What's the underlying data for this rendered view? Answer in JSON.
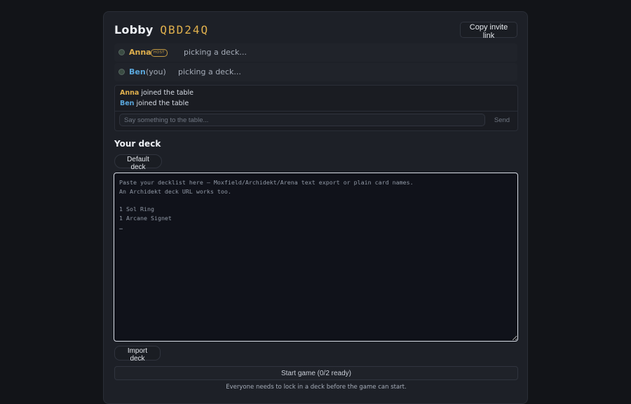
{
  "lobby": {
    "title": "Lobby",
    "code": "QBD24Q",
    "copy_invite_label": "Copy invite link"
  },
  "players": [
    {
      "name": "Anna",
      "badge": "HOST",
      "you_label": "",
      "status": "picking a deck..."
    },
    {
      "name": "Ben",
      "badge": "",
      "you_label": "(you)",
      "status": "picking a deck..."
    }
  ],
  "chat": {
    "messages": [
      {
        "name": "Anna",
        "text": "joined the table"
      },
      {
        "name": "Ben",
        "text": "joined the table"
      }
    ],
    "input_placeholder": "Say something to the table...",
    "input_value": "",
    "send_label": "Send"
  },
  "deck": {
    "section_title": "Your deck",
    "default_deck_label": "Default deck",
    "textarea_placeholder": "Paste your decklist here — Moxfield/Archidekt/Arena text export or plain card names.\nAn Archidekt deck URL works too.\n\n1 Sol Ring\n1 Arcane Signet\n…",
    "textarea_value": "",
    "import_label": "Import deck"
  },
  "start": {
    "button_label": "Start game (0/2 ready)",
    "hint": "Everyone needs to lock in a deck before the game can start."
  },
  "colors": {
    "background": "#121418",
    "panel": "#1d2027",
    "accent_gold": "#e0b04d",
    "accent_blue": "#5aa7dc"
  }
}
